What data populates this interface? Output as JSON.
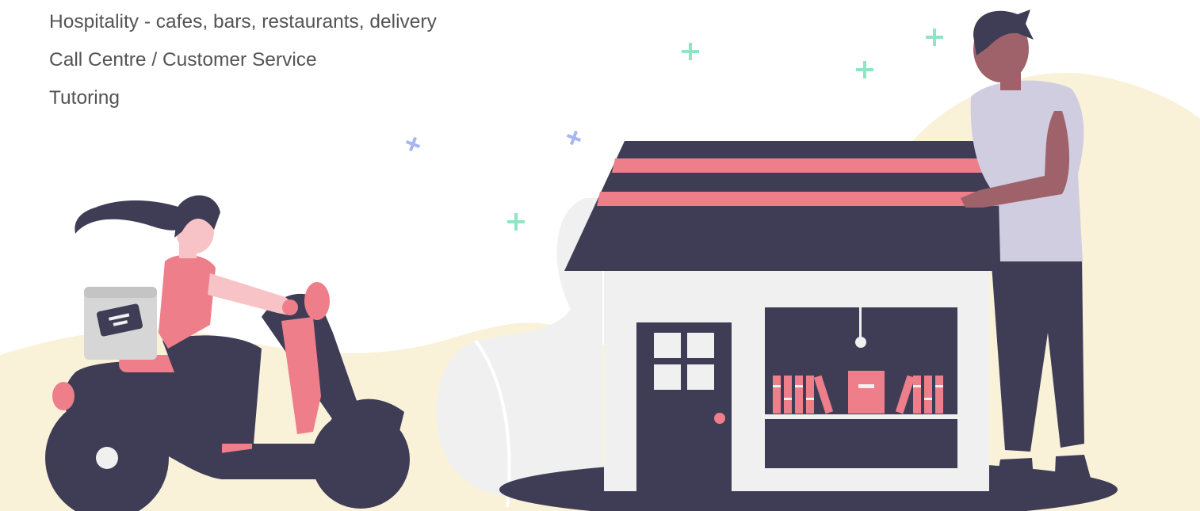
{
  "job_list": {
    "items": [
      "Hospitality - cafes, bars, restaurants, delivery",
      "Call Centre / Customer Service",
      "Tutoring"
    ]
  },
  "illustration": {
    "subjects": [
      "delivery-scooter-rider",
      "shop-storefront",
      "shopkeeper-person"
    ],
    "colors": {
      "dark": "#3f3d56",
      "accent": "#ee7e89",
      "skin": "#9f616a",
      "shirt": "#d0cde1",
      "ground": "#f9f2d8",
      "wall": "#f0f0f0",
      "sparkle_green": "#8ee5c4",
      "sparkle_blue": "#a7b6f3"
    }
  }
}
